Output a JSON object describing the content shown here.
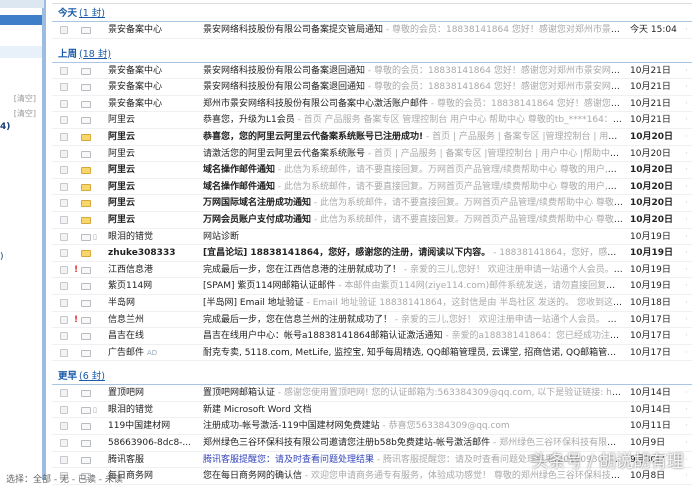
{
  "sidebar": {
    "clear1": "[清空]",
    "clear2": "[清空]",
    "count1": "4)",
    "count2": ")"
  },
  "groups": [
    {
      "title": "今天",
      "count": "(1 封)",
      "rows": [
        {
          "from": "景安备案中心",
          "subject": "景安网络科技股份有限公司备案提交管局通知",
          "summary": " - 尊敬的会员：18838141864 您好！感谢您对郑州市景安网络科技股份...",
          "date": "今天 15:04",
          "unread": false
        }
      ]
    },
    {
      "title": "上周",
      "count": "(18 封)",
      "rows": [
        {
          "from": "景安备案中心",
          "subject": "景安网络科技股份有限公司备案退回通知",
          "summary": " - 尊敬的会员：18838141864 您好！感谢您对郑州市景安网络科技股份有限...",
          "date": "10月21日",
          "unread": false
        },
        {
          "from": "景安备案中心",
          "subject": "景安网络科技股份有限公司备案退回通知",
          "summary": " - 尊敬的会员：18838141864 您好！感谢您对郑州市景安网络科技股份有限...",
          "date": "10月21日",
          "unread": false
        },
        {
          "from": "景安备案中心",
          "subject": "郑州市景安网络科技股份有限公司备案中心激活账户邮件",
          "summary": " - 尊敬的会员：18838141864 您好！感谢您对郑州市景安网...",
          "date": "10月21日",
          "unread": false
        },
        {
          "from": "阿里云",
          "subject": "恭喜您，升级为L1会员",
          "summary": " - 首页 产品服务 备案专区 管理控制台 用户中心 帮助中心 尊敬的tb_****164：恭喜您，升...",
          "date": "10月21日",
          "unread": false
        },
        {
          "from": "阿里云",
          "subject": "恭喜您，您的阿里云阿里云代备案系统账号已注册成功!",
          "summary": " - 首页 | 产品服务 | 备案专区 |管理控制台 | 用户中心 |帮助中...",
          "date": "10月20日",
          "unread": true
        },
        {
          "from": "阿里云",
          "subject": "请激活您的阿里云阿里云代备案系统账号",
          "summary": " - 首页 | 产品服务 | 备案专区 |管理控制台 | 用户中心 |帮助中心 尊敬的563...",
          "date": "10月20日",
          "unread": false
        },
        {
          "from": "阿里云",
          "subject": "域名操作邮件通知",
          "summary": " - 此信为系统邮件，请不要直接回复。万网首页产品管理/续费帮助中心 尊敬的用户,您好！ 您的以下...",
          "date": "10月20日",
          "unread": true
        },
        {
          "from": "阿里云",
          "subject": "域名操作邮件通知",
          "summary": " - 此信为系统邮件，请不要直接回复。万网首页产品管理/续费帮助中心 尊敬的用户,您好！ 您的以下...",
          "date": "10月20日",
          "unread": true
        },
        {
          "from": "阿里云",
          "subject": "万网国际域名注册成功通知",
          "summary": " - 此信为系统邮件，请不要直接回复。万网首页产品管理/续费帮助中心 尊敬的用户tb_682...",
          "date": "10月20日",
          "unread": true
        },
        {
          "from": "阿里云",
          "subject": "万网会员账户支付成功通知",
          "summary": " - 此信为系统邮件，请不要直接回复。万网首页产品管理/续费帮助中心 尊敬的用户tb_682...",
          "date": "10月20日",
          "unread": true
        },
        {
          "from": "眼泪的错觉",
          "subject": "网站诊断",
          "summary": "",
          "date": "10月19日",
          "unread": false,
          "attach": true
        },
        {
          "from": "zhuke308333",
          "subject": "[宜昌论坛] 18838141864，您好，感谢您的注册，请阅读以下内容。",
          "summary": " - 18838141864，您好，感谢您的注册，...",
          "date": "10月19日",
          "unread": true
        },
        {
          "from": "江西信息港",
          "subject": "完成最后一步，您在江西信息港的注册就成功了！",
          "summary": " - 亲爱的三儿,您好！ 欢迎注册申请一站通个人会员。 现在还差最...",
          "date": "10月19日",
          "unread": false,
          "flag": true
        },
        {
          "from": "紫页114网",
          "subject": "[SPAM] 紫页114网邮箱认证邮件",
          "summary": " - 本邮件由紫页114网(ziye114.com)邮件系统发送，请勿直接回复本邮件！",
          "date": "10月19日",
          "unread": false
        },
        {
          "from": "半岛网",
          "subject": "[半岛网] Email 地址验证",
          "summary": " - Email 地址验证 18838141864，这封信是由 半岛社区 发送的。 您收到这封邮件，是由...",
          "date": "10月18日",
          "unread": false
        },
        {
          "from": "信息兰州",
          "subject": "完成最后一步，您在信息兰州的注册就成功了！",
          "summary": " - 亲爱的三儿,您好！ 欢迎注册申请一站通个人会员。 现在还差最后...",
          "date": "10月17日",
          "unread": false,
          "flag": true
        },
        {
          "from": "昌吉在线",
          "subject": "昌吉在线用户中心：帐号a18838141864邮箱认证激活通知",
          "summary": " - 亲爱的a18838141864：您已经成功注册为本站会员...",
          "date": "10月17日",
          "unread": false
        },
        {
          "from": "广告邮件",
          "ad": "AD",
          "subject": "耐克专卖, 5118.com, MetLife, 监控宝, 知乎每周精选, QQ邮箱管理员, 云课堂, 招商信诺, QQ邮箱管理员, 招商信诺,...",
          "summary": "",
          "date": "10月17日",
          "unread": false
        }
      ]
    },
    {
      "title": "更早",
      "count": "(6 封)",
      "rows": [
        {
          "from": "置顶吧网",
          "subject": "置顶吧网邮箱认证",
          "summary": " - 感谢您使用置顶吧网! 您的认证邮箱为:563384309@qq.com, 以下是验证链接: http://my.zhi...",
          "date": "10月14日",
          "unread": false
        },
        {
          "from": "眼泪的错觉",
          "subject": "新建 Microsoft Word 文档",
          "summary": "",
          "date": "10月14日",
          "unread": false,
          "attach": true
        },
        {
          "from": "119中国建材网",
          "subject": "注册成功-帐号激活-119中国建材网免费建站",
          "summary": " - 恭喜您563384309@qq.com",
          "date": "10月11日",
          "unread": false
        },
        {
          "from": "58663906-8dc8-...",
          "subject": "郑州绿色三谷环保科技有限公司邀请您注册b58b免费建站-帐号激活邮件",
          "summary": " - 郑州绿色三谷环保科技有限公司，您好：感...",
          "date": "10月9日",
          "unread": false
        },
        {
          "from": "腾讯客服",
          "subject": "腾讯客服提醒您：请及时查看问题处理结果",
          "summary": " - 腾讯客服提醒您：请及时查看问题处理结果(20160930 17:06:03) 亲爱...",
          "date": "9月30日",
          "unread": false,
          "blue": true
        },
        {
          "from": "每日商务网",
          "subject": "您在每日商务网的确认信",
          "summary": " - 欢迎您申请商务通专有服务，体验成功感觉！ 尊敬的郑州绿色三谷环保科技有限公司...",
          "date": "10月8日",
          "unread": false
        }
      ]
    }
  ],
  "footer": "选择：全部 - 无 - 已读 - 未读",
  "watermark": "头条号 / 胡说胡有理"
}
